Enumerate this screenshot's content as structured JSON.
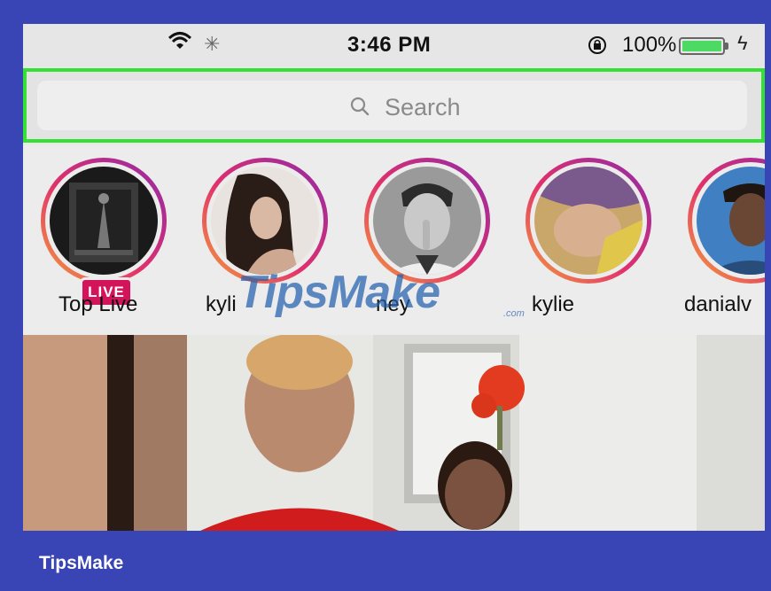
{
  "statusbar": {
    "time": "3:46 PM",
    "battery_percent": "100%",
    "battery_level": 1.0,
    "icons": [
      "wifi-icon",
      "loading-spinner-icon",
      "orientation-lock-icon",
      "battery-icon",
      "charging-bolt-icon"
    ]
  },
  "search": {
    "placeholder": "Search",
    "highlight_color": "#34e034"
  },
  "stories": [
    {
      "label": "Top Live",
      "live": true,
      "live_label": "LIVE"
    },
    {
      "label": "kyli",
      "live": false
    },
    {
      "label": "ney",
      "live": false
    },
    {
      "label": "kylie",
      "live": false
    },
    {
      "label": "danialv",
      "live": false
    }
  ],
  "watermark": {
    "text": "TipsMake",
    "suffix": ".com"
  },
  "footer": {
    "brand": "TipsMake"
  },
  "colors": {
    "frame": "#3a45b5",
    "live_badge": "#d4145a",
    "story_ring_start": "#f4a13a",
    "story_ring_end": "#8f2aa8"
  }
}
